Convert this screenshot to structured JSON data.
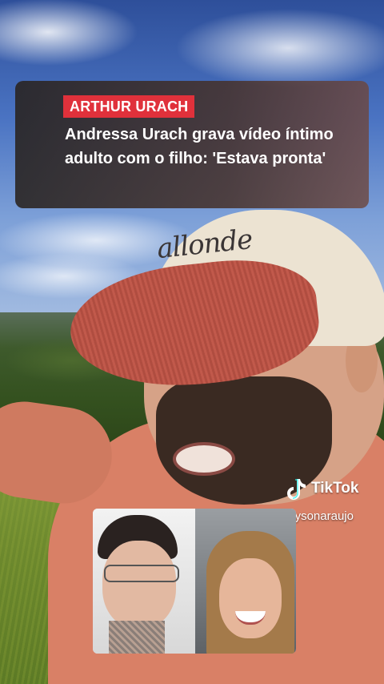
{
  "news": {
    "category": "ARTHUR URACH",
    "headline": "Andressa Urach grava vídeo íntimo adulto com o filho: 'Estava pronta'"
  },
  "cap": {
    "logo_text": "allonde"
  },
  "watermark": {
    "brand": "TikTok",
    "username": "@oglaysonaraujo",
    "icon": "tiktok-logo-icon"
  },
  "colors": {
    "category_tag": "#e0313b",
    "headline_text": "#ffffff"
  }
}
